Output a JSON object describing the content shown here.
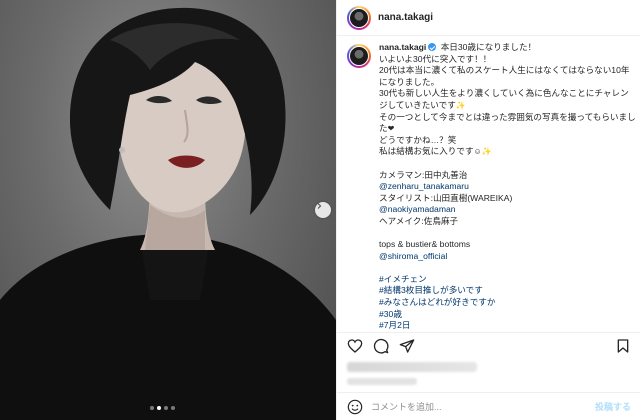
{
  "post": {
    "username": "nana.takagi",
    "carousel": {
      "slide_count": 4,
      "active_index": 1
    },
    "caption": {
      "lines": [
        "いよいよ30代に突入です！！",
        "20代は本当に濃くて私のスケート人生にはなくてはならない10年になりました。",
        "30代も新しい人生をより濃くしていく為に色んなことにチャレンジしていきたいです",
        "その一つとして今までとは違った雰囲気の写真を撮ってもらいました",
        "どうですかね…？笑",
        "私は結構お気に入りです"
      ],
      "first_line": "本日30歳になりました！",
      "credits": [
        {
          "text": "カメラマン:田中丸善治",
          "is_link": false
        },
        {
          "text": "@zenharu_tanakamaru",
          "is_link": true
        },
        {
          "text": "スタイリスト:山田直樹(WAREIKA)",
          "is_link": false
        },
        {
          "text": "@naokiyamadaman",
          "is_link": true
        },
        {
          "text": "ヘアメイク:佐鳥麻子",
          "is_link": false
        }
      ],
      "wardrobe": [
        {
          "text": "tops & bustier& bottoms",
          "is_link": false
        },
        {
          "text": "@shiroma_official",
          "is_link": true
        }
      ],
      "hashtags": [
        "#イメチェン",
        "#結構3枚目推しが多いです",
        "#みなさんはどれが好きですか",
        "#30歳",
        "#7月2日"
      ]
    }
  },
  "comment": {
    "placeholder": "コメントを追加...",
    "post_label": "投稿する"
  },
  "colors": {
    "link": "#00376b",
    "verified": "#3897f0",
    "post_button": "#b2dffc"
  }
}
